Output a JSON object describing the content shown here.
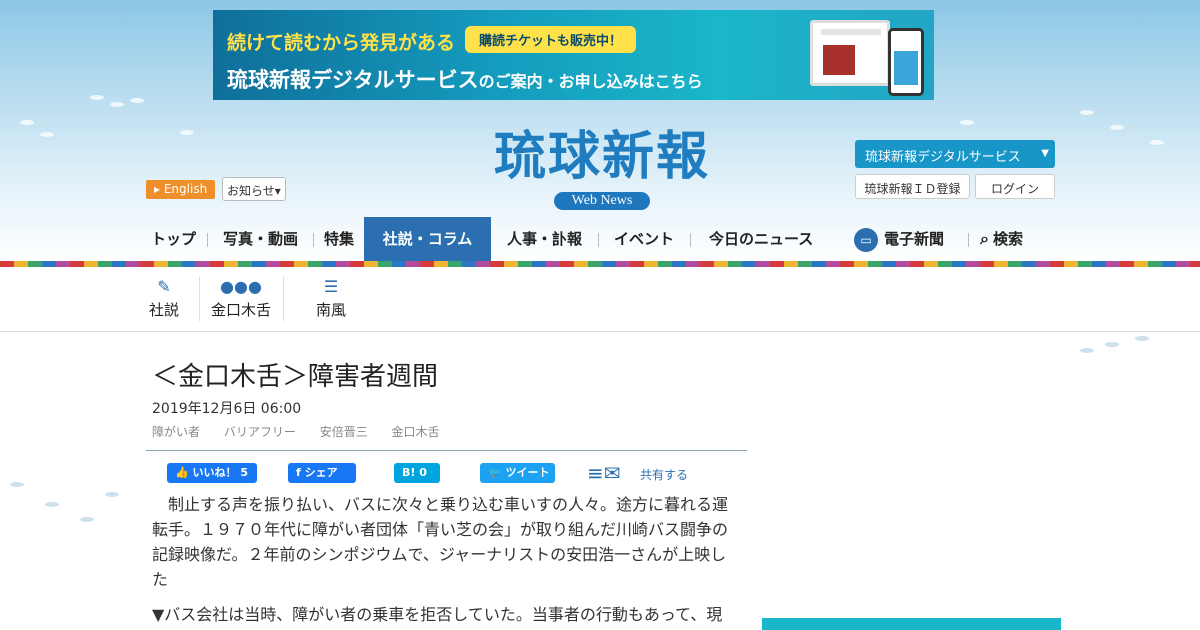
{
  "banner": {
    "line1": "続けて読むから発見がある",
    "badge": "購読チケットも販売中！",
    "line2_main": "琉球新報デジタルサービス",
    "line2_small": "のご案内・お申し込みはこちら",
    "mock_title": "琉球新報"
  },
  "header": {
    "logo_text": "琉球新報",
    "logo_sub": "Web News",
    "english_label": "English",
    "notice_label": "お知らせ",
    "digital_service_label": "琉球新報デジタルサービス",
    "id_register_label": "琉球新報ＩＤ登録",
    "login_label": "ログイン"
  },
  "nav": {
    "items": [
      {
        "label": "トップ"
      },
      {
        "label": "写真・動画"
      },
      {
        "label": "特集"
      },
      {
        "label": "社説・コラム",
        "active": true
      },
      {
        "label": "人事・訃報"
      },
      {
        "label": "イベント"
      },
      {
        "label": "今日のニュース"
      },
      {
        "label": "電子新聞"
      },
      {
        "label": "検索"
      }
    ]
  },
  "subnav": {
    "items": [
      {
        "label": "社説",
        "icon": "pen-icon"
      },
      {
        "label": "金口木舌",
        "icon": "speech-bubble-icon"
      },
      {
        "label": "南風",
        "icon": "message-icon"
      }
    ]
  },
  "article": {
    "title": "＜金口木舌＞障害者週間",
    "date": "2019年12月6日 06:00",
    "tags": [
      "障がい者",
      "バリアフリー",
      "安倍晋三",
      "金口木舌"
    ],
    "share": {
      "like_label": "いいね！",
      "like_count": "5",
      "share_label": "シェア",
      "hatena_label": "B!",
      "hatena_count": "0",
      "tweet_label": "ツイート",
      "share_text": "共有する"
    },
    "paragraphs": [
      "　制止する声を振り払い、バスに次々と乗り込む車いすの人々。途方に暮れる運転手。１９７０年代に障がい者団体「青い芝の会」が取り組んだ川崎バス闘争の記録映像だ。２年前のシンポジウムで、ジャーナリストの安田浩一さんが上映した",
      "▼バス会社は当時、障がい者の乗車を拒否していた。当事者の行動もあって、現"
    ]
  },
  "colors": {
    "brand_blue": "#1f7dbf",
    "nav_active": "#2b6fb0",
    "english_orange": "#ef8f2b",
    "digital_button": "#1996c8"
  }
}
